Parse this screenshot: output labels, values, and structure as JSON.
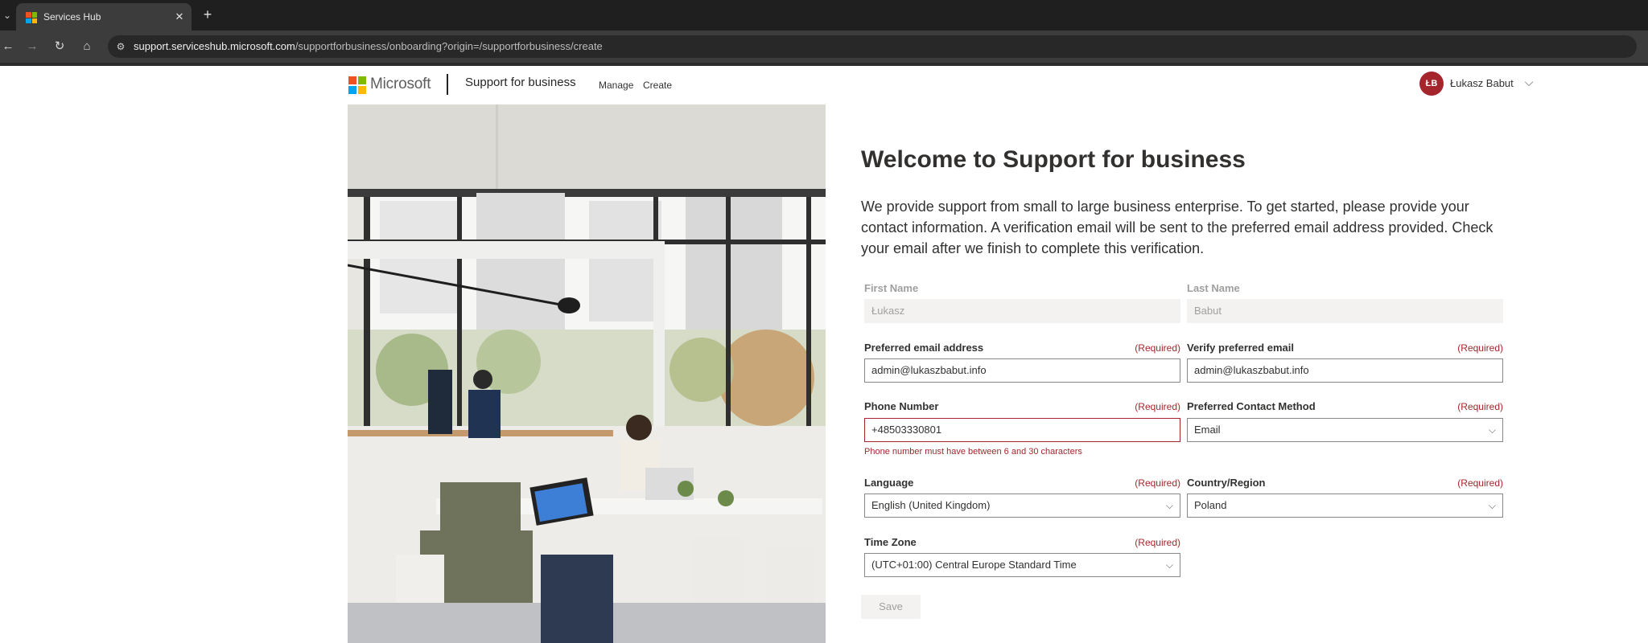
{
  "browser": {
    "tab_title": "Services Hub",
    "url_host": "support.serviceshub.microsoft.com",
    "url_path": "/supportforbusiness/onboarding?origin=/supportforbusiness/create"
  },
  "header": {
    "logo_text": "Microsoft",
    "title": "Support for business",
    "nav": [
      "Manage",
      "Create"
    ],
    "user_initials": "ŁB",
    "user_name": "Łukasz Babut"
  },
  "main": {
    "welcome": "Welcome to Support for business",
    "intro": "We provide support from small to large business enterprise. To get started, please provide your contact information. A verification email will be sent to the preferred email address provided. Check your email after we finish to complete this verification.",
    "required_text": "(Required)",
    "fields": {
      "first_name": {
        "label": "First Name",
        "value": "Łukasz"
      },
      "last_name": {
        "label": "Last Name",
        "value": "Babut"
      },
      "email": {
        "label": "Preferred email address",
        "value": "admin@lukaszbabut.info"
      },
      "verify_email": {
        "label": "Verify preferred email",
        "value": "admin@lukaszbabut.info"
      },
      "phone": {
        "label": "Phone Number",
        "value": "+48503330801",
        "error": "Phone number must have between 6 and 30 characters"
      },
      "contact_method": {
        "label": "Preferred Contact Method",
        "value": "Email"
      },
      "language": {
        "label": "Language",
        "value": "English (United Kingdom)"
      },
      "country": {
        "label": "Country/Region",
        "value": "Poland"
      },
      "time_zone": {
        "label": "Time Zone",
        "value": "(UTC+01:00) Central Europe Standard Time"
      }
    },
    "save_label": "Save"
  },
  "colors": {
    "error": "#a4262c",
    "ms_red": "#f25022",
    "ms_green": "#7fba00",
    "ms_blue": "#00a4ef",
    "ms_yellow": "#ffb900"
  }
}
